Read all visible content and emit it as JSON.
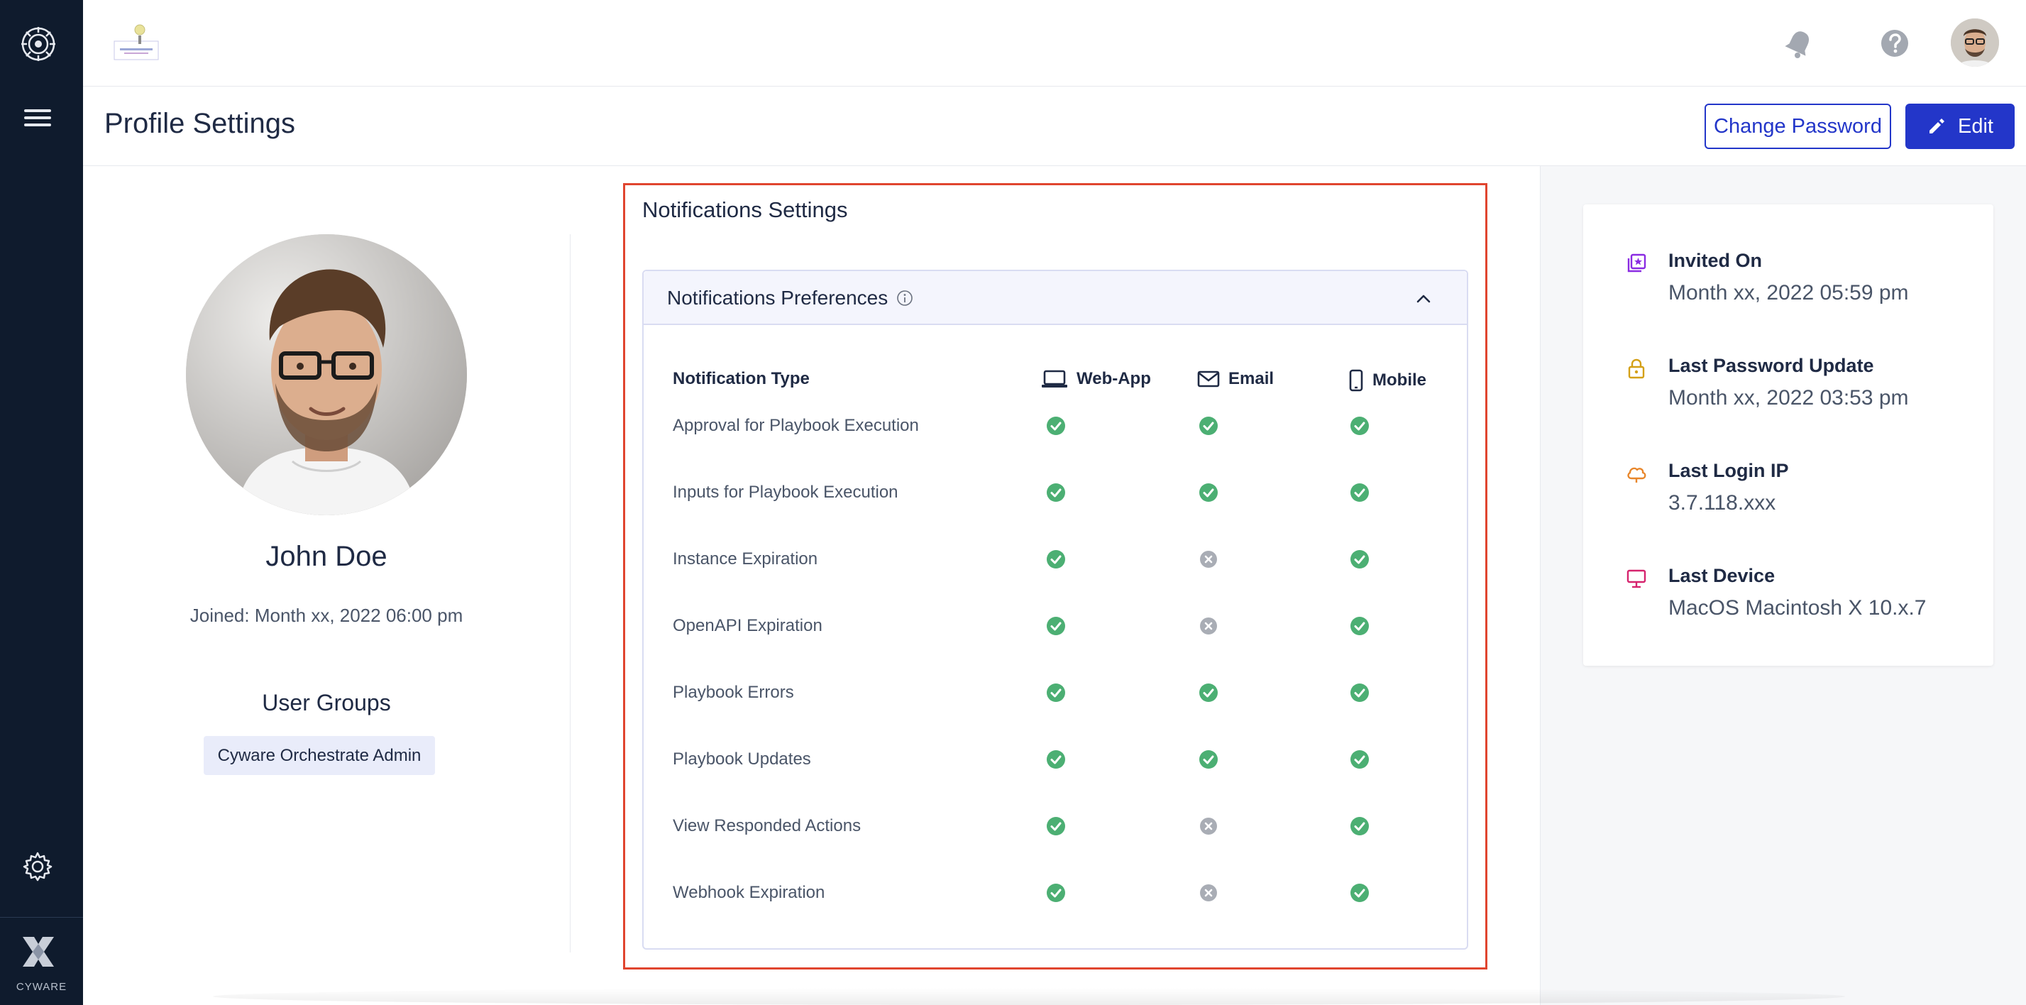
{
  "app": {
    "brand_label": "CYWARE"
  },
  "page": {
    "title": "Profile Settings"
  },
  "header_actions": {
    "change_password": "Change Password",
    "edit": "Edit"
  },
  "profile": {
    "name": "John Doe",
    "joined": "Joined: Month xx, 2022 06:00 pm",
    "groups_title": "User Groups",
    "groups": [
      "Cyware Orchestrate Admin"
    ]
  },
  "notifications": {
    "section_title": "Notifications Settings",
    "panel_title": "Notifications Preferences",
    "columns": {
      "type": "Notification Type",
      "webapp": "Web-App",
      "email": "Email",
      "mobile": "Mobile"
    },
    "rows": [
      {
        "label": "Approval for Playbook Execution",
        "webapp": true,
        "email": true,
        "mobile": true
      },
      {
        "label": "Inputs for Playbook Execution",
        "webapp": true,
        "email": true,
        "mobile": true
      },
      {
        "label": "Instance Expiration",
        "webapp": true,
        "email": false,
        "mobile": true
      },
      {
        "label": "OpenAPI Expiration",
        "webapp": true,
        "email": false,
        "mobile": true
      },
      {
        "label": "Playbook Errors",
        "webapp": true,
        "email": true,
        "mobile": true
      },
      {
        "label": "Playbook Updates",
        "webapp": true,
        "email": true,
        "mobile": true
      },
      {
        "label": "View Responded Actions",
        "webapp": true,
        "email": false,
        "mobile": true
      },
      {
        "label": "Webhook Expiration",
        "webapp": true,
        "email": false,
        "mobile": true
      }
    ]
  },
  "account_info": {
    "invited_label": "Invited On",
    "invited_value": "Month xx, 2022 05:59 pm",
    "password_label": "Last Password Update",
    "password_value": "Month xx, 2022 03:53 pm",
    "ip_label": "Last Login IP",
    "ip_value": "3.7.118.xxx",
    "device_label": "Last Device",
    "device_value": "MacOS Macintosh X 10.x.7"
  },
  "colors": {
    "enabled": "#4caf73",
    "disabled": "#a9adb5",
    "primary": "#2336c9",
    "highlight": "#e0452f",
    "invited_icon": "#8a2be2",
    "password_icon": "#d4a017",
    "ip_icon": "#e8862a",
    "device_icon": "#d6246e"
  }
}
